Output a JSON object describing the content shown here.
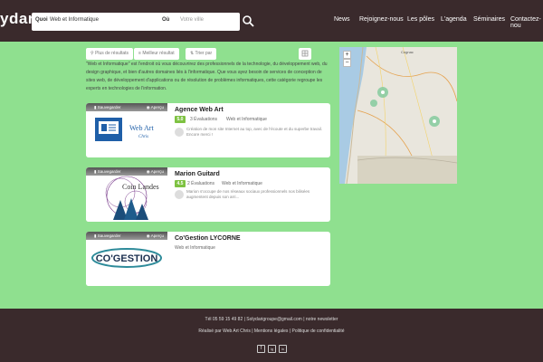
{
  "header": {
    "logo": "ydari",
    "search": {
      "what_label": "Quoi",
      "what_value": "Web et Informatique",
      "where_label": "Où",
      "where_placeholder": "Votre ville"
    },
    "nav": [
      "News",
      "Rejoignez-nous",
      "Les pôles",
      "L'agenda",
      "Séminaires",
      "Contactez-nou"
    ]
  },
  "filters": {
    "buttons": [
      "Plus de résultats",
      "Meilleur résultat",
      "Trier par"
    ]
  },
  "intro": "\"Web et Informatique\" est l'endroit où vous découvrirez des professionnels de la technologie, du développement web, du design graphique, et bien d'autres domaines liés à l'informatique. Que vous ayez besoin de services de conception de sites web, de développement d'applications ou de résolution de problèmes informatiques, cette catégorie regroupe les experts en technologies de l'information.",
  "cards": [
    {
      "save_label": "Sauvegarder",
      "preview_label": "Aperçu",
      "title": "Agence Web Art",
      "score": "5.0",
      "evaluations": "3 Évaluations",
      "category": "Web et Informatique",
      "review": "Création de mon site Internet au top, avec de l'écoute et du superbe travail. Encore merci !",
      "logo_text": "Web Art",
      "logo_sub": "Chris"
    },
    {
      "save_label": "Sauvegarder",
      "preview_label": "Aperçu",
      "title": "Marion Guitard",
      "score": "4.5",
      "evaluations": "2 Évaluations",
      "category": "Web et Informatique",
      "review": "Marion s'occupe de nos réseaux sociaux professionnels nos bilisées augmentent depuis son arri...",
      "logo_text": "Coin Landes"
    },
    {
      "save_label": "Sauvegarder",
      "preview_label": "Aperçu",
      "title": "Co'Gestion LYCORNE",
      "category": "Web et Informatique",
      "logo_text": "CO'GESTION"
    }
  ],
  "map": {
    "zoom_in": "+",
    "zoom_out": "−",
    "label": "Cognac"
  },
  "footer": {
    "contact": "Tél 05 59 15 49 82 | Solydarigroupe@gmail.com | notre newsletter",
    "links": "Réalisé par Web Art Chris | Mentions légales | Politique de confidentialité",
    "social": [
      "f",
      "ig",
      "in"
    ]
  },
  "colors": {
    "background": "#8fe08f",
    "header": "#3a2a2c",
    "score": "#7ec242"
  }
}
